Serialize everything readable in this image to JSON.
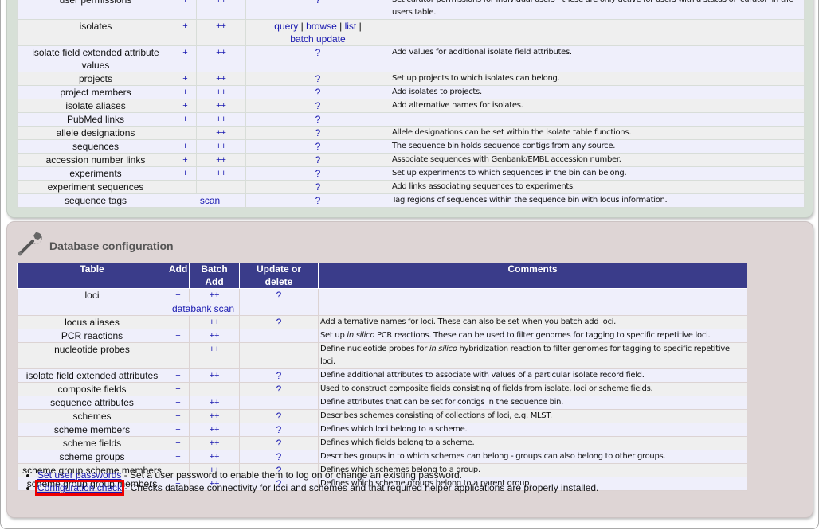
{
  "curator_section": {
    "rows": [
      {
        "table": "user permissions",
        "add": "+",
        "batch": "++",
        "update": "?",
        "comment": "Set curator permissions for individual users - these are only active for users with a status of 'curator' in the users table."
      },
      {
        "table": "isolates",
        "add": "+",
        "batch": "++",
        "update_links": [
          "query",
          "browse",
          "list",
          "batch update"
        ],
        "comment": ""
      },
      {
        "table": "isolate field extended attribute values",
        "add": "+",
        "batch": "++",
        "update": "?",
        "comment": "Add values for additional isolate field attributes."
      },
      {
        "table": "projects",
        "add": "+",
        "batch": "++",
        "update": "?",
        "comment": "Set up projects to which isolates can belong."
      },
      {
        "table": "project members",
        "add": "+",
        "batch": "++",
        "update": "?",
        "comment": "Add isolates to projects."
      },
      {
        "table": "isolate aliases",
        "add": "+",
        "batch": "++",
        "update": "?",
        "comment": "Add alternative names for isolates."
      },
      {
        "table": "PubMed links",
        "add": "+",
        "batch": "++",
        "update": "?",
        "comment": ""
      },
      {
        "table": "allele designations",
        "add": "",
        "batch": "++",
        "update": "?",
        "comment": "Allele designations can be set within the isolate table functions."
      },
      {
        "table": "sequences",
        "add": "+",
        "batch": "++",
        "update": "?",
        "comment": "The sequence bin holds sequence contigs from any source."
      },
      {
        "table": "accession number links",
        "add": "+",
        "batch": "++",
        "update": "?",
        "comment": "Associate sequences with Genbank/EMBL accession number."
      },
      {
        "table": "experiments",
        "add": "+",
        "batch": "++",
        "update": "?",
        "comment": "Set up experiments to which sequences in the bin can belong."
      },
      {
        "table": "experiment sequences",
        "add": "",
        "batch": "",
        "update": "?",
        "comment": "Add links associating sequences to experiments."
      },
      {
        "table": "sequence tags",
        "span": "scan",
        "update": "?",
        "comment": "Tag regions of sequences within the sequence bin with locus information."
      }
    ]
  },
  "config_section": {
    "title": "Database configuration",
    "icon": "wrench-icon",
    "headers": [
      "Table",
      "Add",
      "Batch Add",
      "Update or delete",
      "Comments"
    ],
    "rows": [
      {
        "table": "loci",
        "add": "+",
        "batch": "++",
        "update": "?",
        "sub": "databank scan",
        "comment": ""
      },
      {
        "table": "locus aliases",
        "add": "+",
        "batch": "++",
        "update": "?",
        "comment": "Add alternative names for loci. These can also be set when you batch add loci."
      },
      {
        "table": "PCR reactions",
        "add": "+",
        "batch": "++",
        "update": "",
        "comment_pre": "Set up ",
        "comment_em": "in silico",
        "comment": " PCR reactions. These can be used to filter genomes for tagging to specific repetitive loci."
      },
      {
        "table": "nucleotide probes",
        "add": "+",
        "batch": "++",
        "update": "",
        "comment_pre": "Define nucleotide probes for ",
        "comment_em": "in silico",
        "comment": " hybridization reaction to filter genomes for tagging to specific repetitive loci."
      },
      {
        "table": "isolate field extended attributes",
        "add": "+",
        "batch": "++",
        "update": "?",
        "comment": "Define additional attributes to associate with values of a particular isolate record field."
      },
      {
        "table": "composite fields",
        "add": "+",
        "batch": "",
        "update": "?",
        "comment": "Used to construct composite fields consisting of fields from isolate, loci or scheme fields."
      },
      {
        "table": "sequence attributes",
        "add": "+",
        "batch": "++",
        "update": "",
        "comment": "Define attributes that can be set for contigs in the sequence bin."
      },
      {
        "table": "schemes",
        "add": "+",
        "batch": "++",
        "update": "?",
        "comment": "Describes schemes consisting of collections of loci, e.g. MLST."
      },
      {
        "table": "scheme members",
        "add": "+",
        "batch": "++",
        "update": "?",
        "comment": "Defines which loci belong to a scheme."
      },
      {
        "table": "scheme fields",
        "add": "+",
        "batch": "++",
        "update": "?",
        "comment": "Defines which fields belong to a scheme."
      },
      {
        "table": "scheme groups",
        "add": "+",
        "batch": "++",
        "update": "?",
        "comment": "Describes groups in to which schemes can belong - groups can also belong to other groups."
      },
      {
        "table": "scheme group scheme members",
        "add": "+",
        "batch": "++",
        "update": "?",
        "comment": "Defines which schemes belong to a group."
      },
      {
        "table": "scheme group group members",
        "add": "+",
        "batch": "++",
        "update": "?",
        "comment": "Defines which scheme groups belong to a parent group."
      }
    ],
    "links": [
      {
        "label": "Set user passwords",
        "desc": " - Set a user password to enable them to log on or change an existing password."
      },
      {
        "label": "Configuration check",
        "desc": " - Checks database connectivity for loci and schemes and that required helper applications are properly installed.",
        "highlighted": true
      }
    ]
  },
  "colors": {
    "header": "#3a3c8a",
    "link": "#1818b0",
    "row_odd": "#efeffb",
    "row_even": "#efefef",
    "highlight": "#ee0000"
  }
}
